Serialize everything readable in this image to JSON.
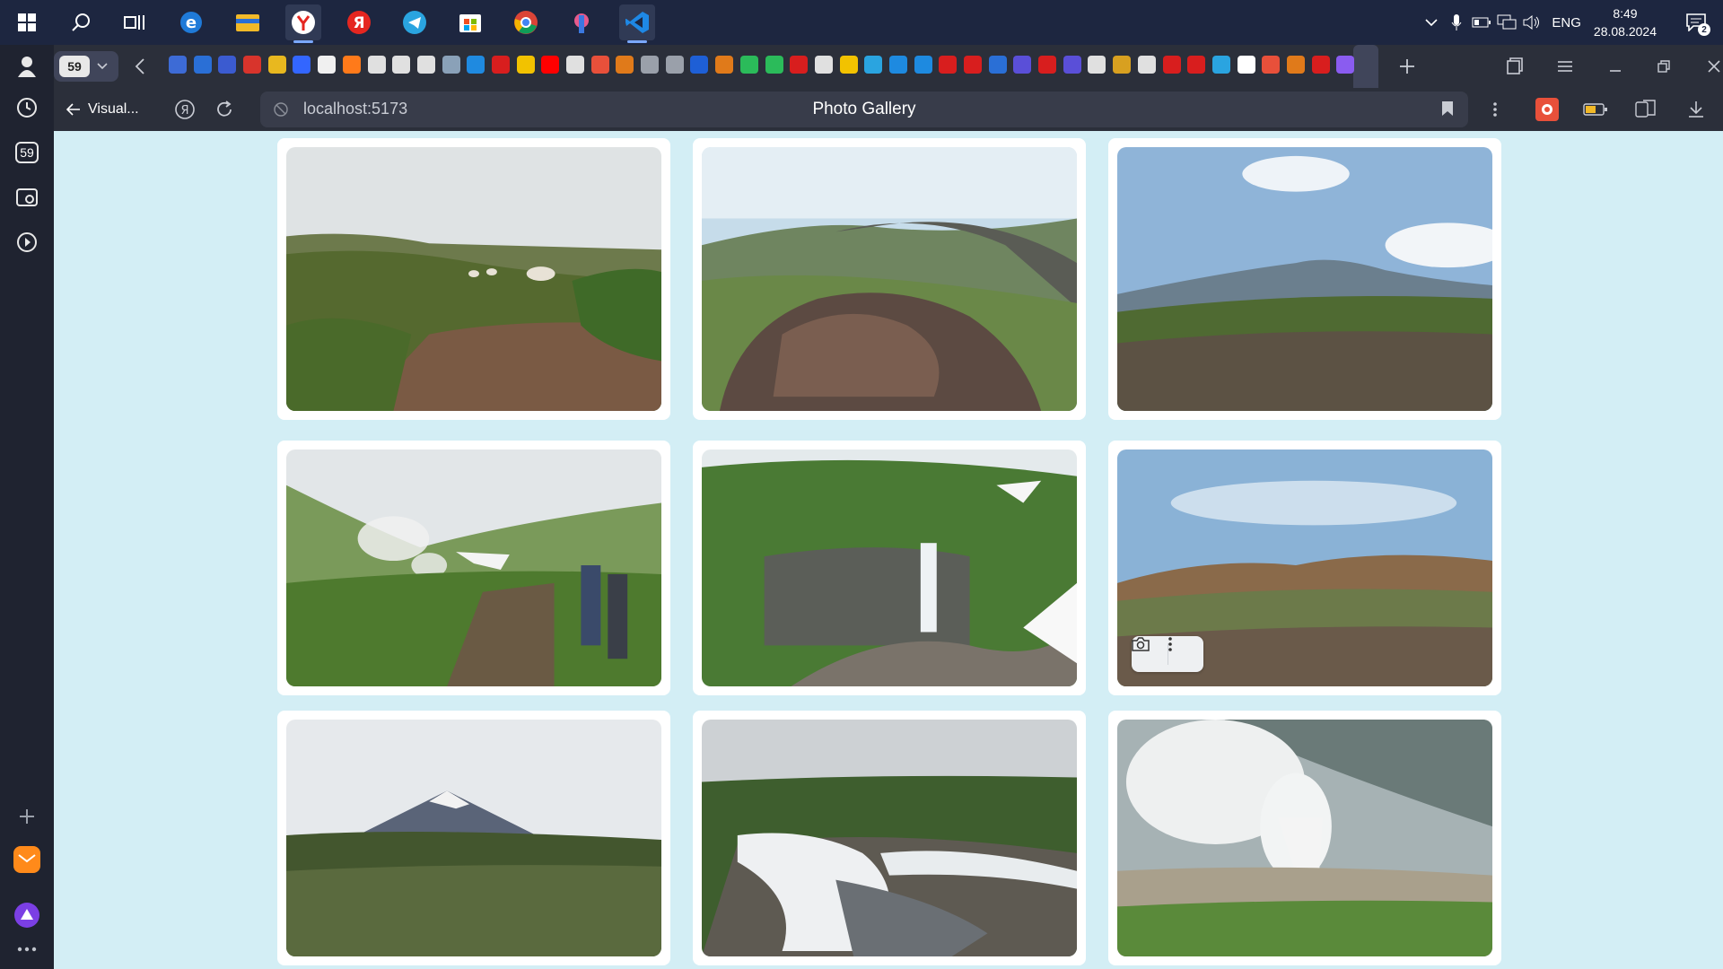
{
  "taskbar": {
    "apps": [
      "start",
      "search",
      "task-view",
      "edge",
      "file-explorer",
      "yandex-browser",
      "yandex",
      "telegram",
      "microsoft-store",
      "chrome",
      "app-unknown",
      "vs-code"
    ],
    "language": "ENG",
    "time": "8:49",
    "date": "28.08.2024",
    "notification_count": "2"
  },
  "sidebar": {
    "tabs_badge": "59",
    "items": [
      "profile-icon",
      "history-icon",
      "tabs-counter-icon",
      "screenshot-icon",
      "video-icon",
      "add-icon",
      "mail-icon",
      "alice-icon",
      "more-icon"
    ]
  },
  "tabstrip": {
    "tab_count": "59",
    "pinned_colors": [
      "#3d6bd6",
      "#2a6fd6",
      "#3b5bd0",
      "#d8342c",
      "#e8b81f",
      "#3366ff",
      "#f0f0f0",
      "#ff7a1a",
      "#e0e0e0",
      "#e0e0e0",
      "#e0e0e0",
      "#8aa1b8",
      "#1f8ae0",
      "#d81e1e",
      "#f2c200",
      "#ff0000",
      "#e0e0e0",
      "#e8503a",
      "#e07a1a",
      "#9aa0aa",
      "#9aa0aa",
      "#1e5fd6",
      "#e07a1a",
      "#2bbb5a",
      "#2bbb5a",
      "#d81e1e",
      "#e0e0e0",
      "#f2c200",
      "#2aa4e0",
      "#1e8ae0",
      "#1e8ae0",
      "#d81e1e",
      "#d81e1e",
      "#2a6fd6",
      "#5a4fd8",
      "#d81e1e",
      "#5a4fd8",
      "#e0e0e0",
      "#d8a020",
      "#e0e0e0",
      "#d81e1e",
      "#d81e1e",
      "#2aa4e0",
      "#ffffff",
      "#e8503a",
      "#e07a1a",
      "#d81e1e",
      "#8a5cf0"
    ]
  },
  "addressbar": {
    "back_label": "Visual...",
    "url": "localhost:5173",
    "page_title": "Photo Gallery"
  },
  "gallery": {
    "photos": [
      {
        "name": "photo-tundra-camp"
      },
      {
        "name": "photo-volcanic-rock"
      },
      {
        "name": "photo-volcano-plain"
      },
      {
        "name": "photo-hikers-fumaroles"
      },
      {
        "name": "photo-waterfall"
      },
      {
        "name": "photo-colored-hills"
      },
      {
        "name": "photo-volcano-cone"
      },
      {
        "name": "photo-snowy-stream"
      },
      {
        "name": "photo-steam-geyser"
      }
    ],
    "hover_toolbar": [
      "camera-icon",
      "more-vertical-icon"
    ]
  }
}
